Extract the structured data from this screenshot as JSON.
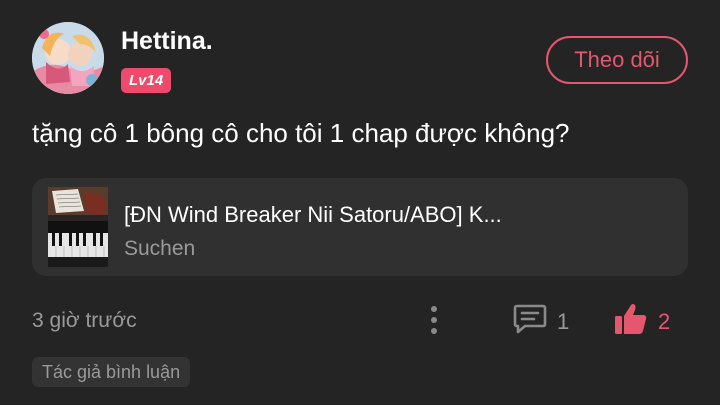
{
  "user": {
    "name": "Hettina.",
    "level": "Lv14",
    "avatar_icon": "avatar-image"
  },
  "follow_button": {
    "label": "Theo dõi"
  },
  "comment": {
    "text": "tặng cô 1 bông cô cho tôi 1 chap được không?",
    "timestamp": "3 giờ trước",
    "reply_count": "1",
    "like_count": "2",
    "author_tag": "Tác giả bình luận"
  },
  "story": {
    "title": "[ĐN Wind Breaker Nii Satoru/ABO] K...",
    "author": "Suchen",
    "cover_icon": "piano-cover-image"
  },
  "icons": {
    "more": "more-vertical-icon",
    "comment": "comment-icon",
    "like": "thumbs-up-icon"
  },
  "colors": {
    "background": "#242425",
    "card": "#303031",
    "accent": "#e5566f",
    "badge": "#ef4a6b",
    "muted_text": "#9a9a9a"
  }
}
